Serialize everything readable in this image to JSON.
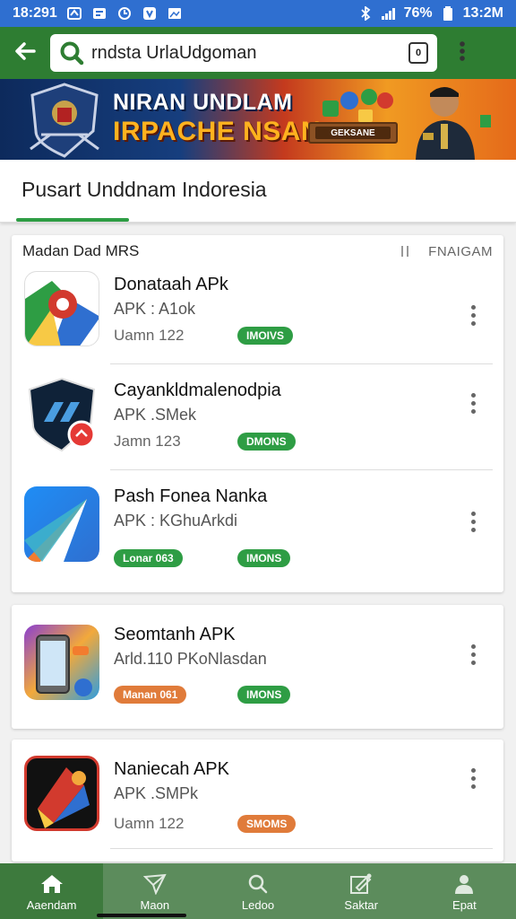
{
  "status_bar": {
    "time_left": "18:291",
    "battery": "76%",
    "time_right": "13:2M",
    "background": "#2f6fd0"
  },
  "app_bar": {
    "search_value": "rndsta UrlaUdgoman",
    "tab_count": "0",
    "background": "#2e7d32"
  },
  "banner": {
    "title_line1": "NIRAN UNDLAM",
    "title_line2": "IRPACHE NSAN",
    "badge_text": "GEKSANE"
  },
  "page": {
    "title": "Pusart Unddnam Indoresia"
  },
  "section": {
    "title": "Madan Dad MRS",
    "right_label": "FNAIGAM"
  },
  "apps": [
    {
      "name": "Donataah APk",
      "subtitle": "APK : A1ok",
      "date": "Uamn 122",
      "tag": "",
      "status": "IMOIVS"
    },
    {
      "name": "Cayankldmalenodpia",
      "subtitle": "APK .SMek",
      "date": "Jamn 123",
      "tag": "",
      "status": "DMONS"
    },
    {
      "name": "Pash Fonea Nanka",
      "subtitle": "APK : KGhuArkdi",
      "date": "",
      "tag": "Lonar 063",
      "status": "IMONS"
    },
    {
      "name": "Seomtanh APK",
      "subtitle": "Arld.110 PKoNlasdan",
      "date": "",
      "tag": "Manan 061",
      "status": "IMONS"
    },
    {
      "name": "Naniecah APK",
      "subtitle": "APK .SMPk",
      "date": "Uamn 122",
      "tag": "",
      "status": "SMOMS"
    }
  ],
  "colors": {
    "accent_green": "#2e9d44",
    "accent_orange": "#e07b3a"
  },
  "bottom_nav": [
    {
      "label": "Aaendam",
      "icon": "home-icon"
    },
    {
      "label": "Maon",
      "icon": "paper-plane-icon"
    },
    {
      "label": "Ledoo",
      "icon": "search-icon"
    },
    {
      "label": "Saktar",
      "icon": "edit-icon"
    },
    {
      "label": "Epat",
      "icon": "person-icon"
    }
  ]
}
